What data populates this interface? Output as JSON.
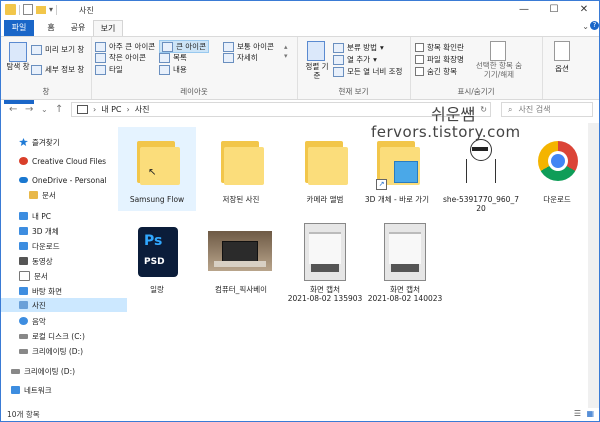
{
  "window": {
    "title": "사진",
    "minimize": "—",
    "maximize": "☐",
    "close": "✕"
  },
  "tabs": [
    "파일",
    "홈",
    "공유",
    "보기"
  ],
  "ribbon": {
    "pane": {
      "nav_label": "탐색 창",
      "preview": "미리 보기 창",
      "details_pane": "세부 정보 창",
      "group": "창"
    },
    "layout": {
      "items": [
        "아주 큰 아이콘",
        "큰 아이콘",
        "보통 아이콘",
        "작은 아이콘",
        "목록",
        "자세히",
        "타일",
        "내용"
      ],
      "selected": "큰 아이콘",
      "group": "레이아웃"
    },
    "current_view": {
      "sort": "정렬 기준",
      "group_by": "분류 방법",
      "add_col": "열 추가",
      "fit_cols": "모든 열 너비 조정",
      "group": "현재 보기"
    },
    "show_hide": {
      "item_check": "항목 확인란",
      "file_ext": "파일 확장명",
      "hidden": "숨긴 항목",
      "hide_sel": "선택한 항목 숨기기/해제",
      "group": "표시/숨기기"
    },
    "options": "옵션"
  },
  "address": {
    "root": "내 PC",
    "current": "사진",
    "search_placeholder": "사진 검색"
  },
  "nav": [
    {
      "label": "즐겨찾기",
      "icon": "star-icon",
      "color": "#1e7ad6"
    },
    {
      "label": "Creative Cloud Files",
      "icon": "creative-cloud-icon",
      "color": "#d93f2a"
    },
    {
      "label": "OneDrive - Personal",
      "icon": "onedrive-icon",
      "color": "#1a78d0"
    },
    {
      "label": "문서",
      "icon": "folder-icon",
      "color": "#e8b84a"
    },
    {
      "label": "내 PC",
      "icon": "pc-icon",
      "color": "#3d8de0"
    },
    {
      "label": "3D 개체",
      "icon": "3d-icon",
      "color": "#3d8de0"
    },
    {
      "label": "다운로드",
      "icon": "download-icon",
      "color": "#3d8de0"
    },
    {
      "label": "동영상",
      "icon": "video-icon",
      "color": "#555555"
    },
    {
      "label": "문서",
      "icon": "document-icon",
      "color": "#777777"
    },
    {
      "label": "바탕 화면",
      "icon": "desktop-icon",
      "color": "#3d8de0"
    },
    {
      "label": "사진",
      "icon": "picture-icon",
      "color": "#6aa0d8"
    },
    {
      "label": "음악",
      "icon": "music-icon",
      "color": "#3d8de0"
    },
    {
      "label": "로컬 디스크 (C:)",
      "icon": "drive-icon",
      "color": "#888888"
    },
    {
      "label": "크리에이팅 (D:)",
      "icon": "drive-icon",
      "color": "#888888"
    },
    {
      "label": "크리에이팅 (D:)",
      "icon": "drive-icon",
      "color": "#888888"
    },
    {
      "label": "네트워크",
      "icon": "network-icon",
      "color": "#3d8de0"
    }
  ],
  "files": [
    {
      "name": "Samsung Flow",
      "kind": "folder"
    },
    {
      "name": "저장된 사진",
      "kind": "folder"
    },
    {
      "name": "카메라 앨범",
      "kind": "folder"
    },
    {
      "name": "3D 개체 - 바로 가기",
      "kind": "shortcut3d"
    },
    {
      "name": "she-5391770_960_720",
      "kind": "sketch"
    },
    {
      "name": "다운로드",
      "kind": "chrome"
    },
    {
      "name": "일랑",
      "kind": "psd",
      "badge": "Ps",
      "sub": "PSD"
    },
    {
      "name": "컴퓨터_픽사베이",
      "kind": "photo"
    },
    {
      "name": "화면 캡처 2021-08-02 135903",
      "line1": "화면 캡처",
      "line2": "2021-08-02 135903",
      "kind": "screen"
    },
    {
      "name": "화면 캡처 2021-08-02 140023",
      "line1": "화면 캡처",
      "line2": "2021-08-02 140023",
      "kind": "screen"
    }
  ],
  "status": "10개 항목",
  "watermark": {
    "line1": "쉬운쌤",
    "line2": "fervors.tistory.com"
  },
  "colors": {
    "accent": "#1a66c8",
    "folder": "#f2c64a",
    "selection": "#cce8ff"
  }
}
